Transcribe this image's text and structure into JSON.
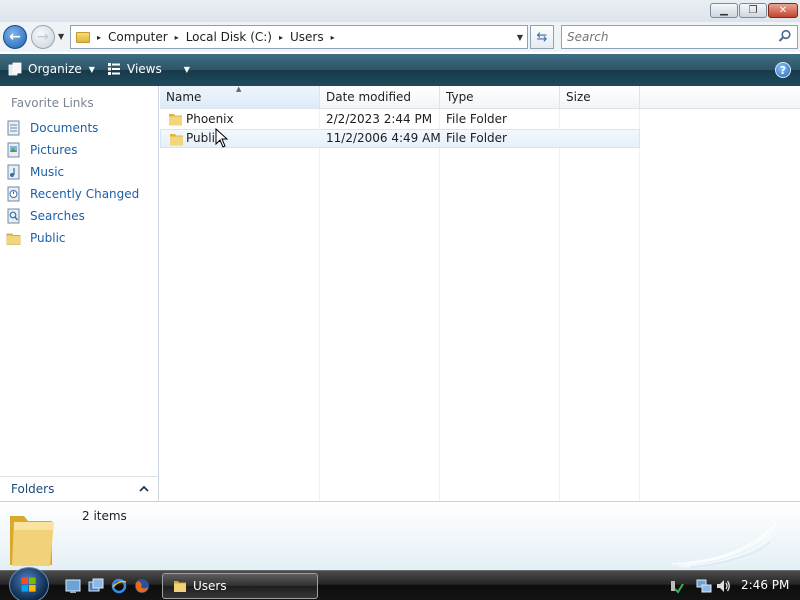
{
  "window": {
    "minimize_glyph": "▁",
    "maximize_glyph": "❐",
    "close_glyph": "✕"
  },
  "address": {
    "breadcrumbs": [
      "Computer",
      "Local Disk (C:)",
      "Users"
    ],
    "separator": "▸"
  },
  "search": {
    "placeholder": "Search"
  },
  "toolbar": {
    "organize_label": "Organize",
    "views_label": "Views",
    "help_glyph": "?"
  },
  "sidebar": {
    "header": "Favorite Links",
    "items": [
      {
        "label": "Documents",
        "icon": "documents-icon"
      },
      {
        "label": "Pictures",
        "icon": "pictures-icon"
      },
      {
        "label": "Music",
        "icon": "music-icon"
      },
      {
        "label": "Recently Changed",
        "icon": "recently-changed-icon"
      },
      {
        "label": "Searches",
        "icon": "searches-icon"
      },
      {
        "label": "Public",
        "icon": "folder-icon"
      }
    ],
    "folders_label": "Folders"
  },
  "filelist": {
    "columns": {
      "name": "Name",
      "date": "Date modified",
      "type": "Type",
      "size": "Size"
    },
    "rows": [
      {
        "name": "Phoenix",
        "date": "2/2/2023 2:44 PM",
        "type": "File Folder",
        "size": ""
      },
      {
        "name": "Public",
        "date": "11/2/2006 4:49 AM",
        "type": "File Folder",
        "size": ""
      }
    ]
  },
  "details": {
    "item_count": "2 items"
  },
  "taskbar": {
    "window_button_label": "Users",
    "clock": "2:46 PM"
  },
  "colors": {
    "link_blue": "#1c5fa8",
    "command_bar": "#2e5466",
    "folder_yellow": "#e8c35a"
  }
}
